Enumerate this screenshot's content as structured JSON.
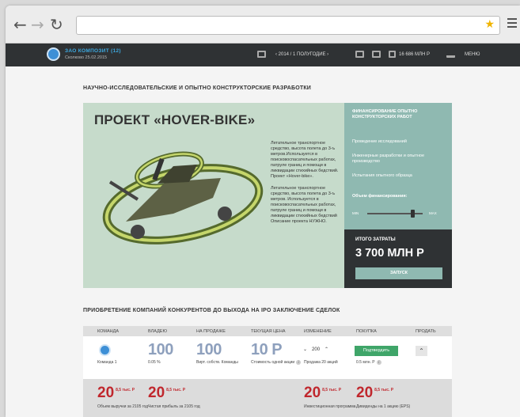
{
  "header": {
    "company": "ЗАО КОМПОЗИТ (12)",
    "date": "Сколково 25.02.2015",
    "period": "‹  2014 / 1 ПОЛУГОДИЕ  ›",
    "funds": "16 686 МЛН Р",
    "menu": "МЕНЮ"
  },
  "rnd": {
    "section_title": "НАУЧНО-ИССЛЕДОВАТЕЛЬСКИЕ И ОПЫТНО КОНСТРУКТОРСКИЕ РАЗРАБОТКИ",
    "project_title": "ПРОЕКТ «HOVER-BIKE»",
    "desc1": "Летательное транспортное средство, высота полета до 3-ъ метров.Используется в поисковоспасательных работах, патруле границ и помощи в ликвидации стихийных бедствий. Проект «Hover-bike».",
    "desc2": "Летательное транспортное средство, высота полета до 3-ъ метров. Используется в поисковоспасательных работах, патруле границ и помощи в ликвидации стихийных бедствий Описание проекта НУЖНО."
  },
  "funding": {
    "title": "ФИНАНСИРОВАНИЕ ОПЫТНО КОНСТРУКТОРСКИХ РАБОТ",
    "stage1": "Проведение исследований",
    "stage2": "Инженерные разработки и опытное производство",
    "stage3": "Испытания опытного образца",
    "volume_label": "Объем финансирования:",
    "min": "MIN",
    "max": "MAX",
    "level": 0.78,
    "total_label": "ИТОГО ЗАТРАТЫ",
    "total_value": "3 700 МЛН Р",
    "launch": "ЗАПУСК"
  },
  "acq": {
    "section_title": "ПРИОБРЕТЕНИЕ КОМПАНИЙ КОНКУРЕНТОВ ДО ВЫХОДА НА IPO ЗАКЛЮЧЕНИЕ СДЕЛОК",
    "columns": [
      "КОМАНДА",
      "ВЛАДЕЮ",
      "НА ПРОДАЖЕ",
      "ТЕКУЩАЯ ЦЕНА",
      "ИЗМЕНЕНИЕ",
      "ПОКУПКА",
      "ПРОДАТЬ"
    ],
    "row": {
      "team": "Команда 1",
      "own": "100",
      "own_pct": "0.05 %",
      "sale": "100",
      "sale_label": "Вирт. собств. Команды",
      "price": "10 Р",
      "price_label": "Стоимость одной акции",
      "change_val": "200",
      "change_label": "Продажа 20 акций",
      "confirm": "Подтвердить",
      "buy_label": "0.5 млн. Р"
    },
    "stats": [
      {
        "value": "20",
        "delta": "8,5 тыс. Р",
        "label": "Объем выручки за 2105 год"
      },
      {
        "value": "20",
        "delta": "8,5 тыс. Р",
        "label": "Чистая прибыль за 2105 год"
      },
      {
        "value": "20",
        "delta": "8,5 тыс. Р",
        "label": "Инвестиционная программа"
      },
      {
        "value": "20",
        "delta": "8,5 тыс. Р",
        "label": "Дивиденды на 1 акцию (EPS)"
      }
    ]
  }
}
